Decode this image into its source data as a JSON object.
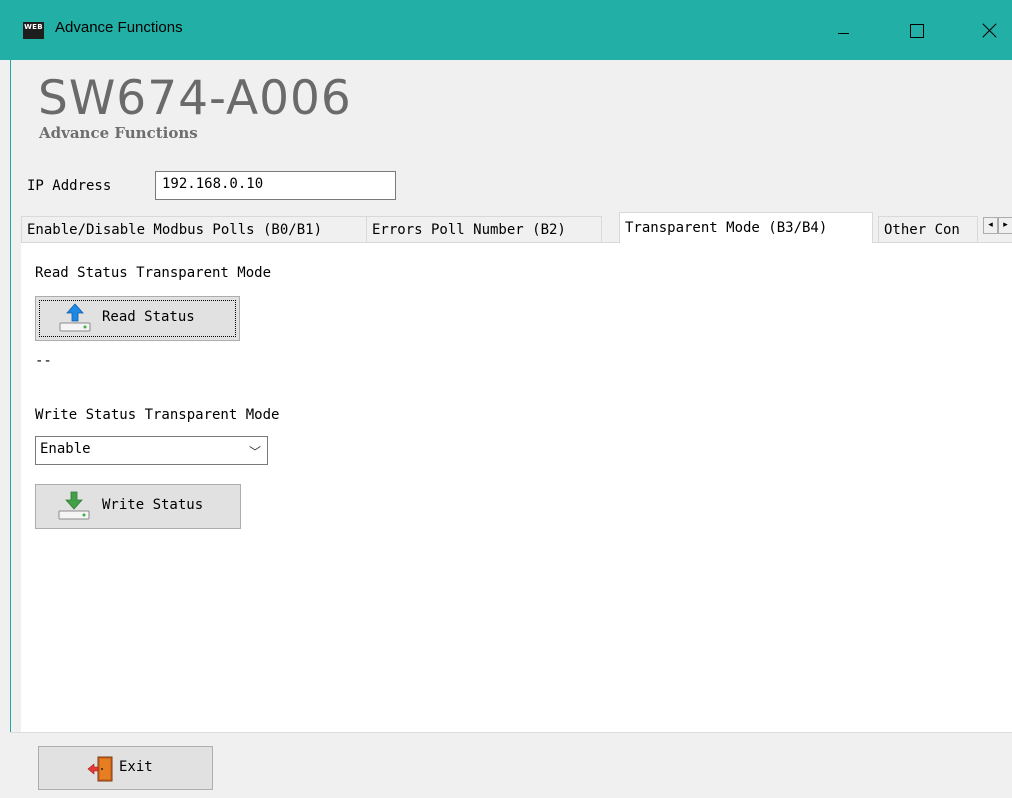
{
  "window": {
    "app_icon_text": "WEB",
    "title": "Advance Functions",
    "controls": {
      "minimize_icon": "minimize-icon",
      "maximize_icon": "maximize-icon",
      "close_icon": "close-icon"
    }
  },
  "header": {
    "app_title": "SW674-A006",
    "app_subtitle": "Advance Functions"
  },
  "ip": {
    "label": "IP Address",
    "value": "192.168.0.10"
  },
  "tabs": [
    {
      "label": "Enable/Disable Modbus Polls (B0/B1)",
      "active": false
    },
    {
      "label": "Errors Poll Number (B2)",
      "active": false
    },
    {
      "label": "Transparent Mode (B3/B4)",
      "active": true
    },
    {
      "label": "Other Con",
      "active": false
    }
  ],
  "tab_scroll": {
    "left": "◂",
    "right": "▸"
  },
  "panel": {
    "read_section_label": "Read Status Transparent Mode",
    "read_button_label": "Read Status",
    "read_status_value": "--",
    "write_section_label": "Write Status Transparent Mode",
    "write_select_value": "Enable",
    "write_button_label": "Write Status"
  },
  "footer": {
    "exit_label": "Exit"
  },
  "colors": {
    "titlebar": "#22b0a6",
    "read_arrow": "#1e88e5",
    "write_arrow": "#43a047"
  }
}
